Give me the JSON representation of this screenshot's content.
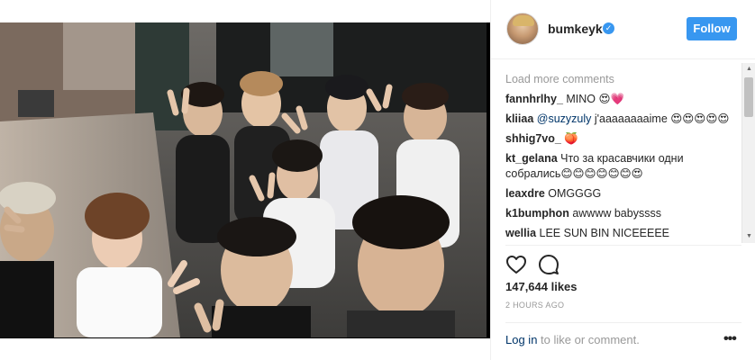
{
  "post": {
    "username": "bumkeyk",
    "verified_mark": "✓",
    "follow_label": "Follow",
    "load_more": "Load more comments",
    "likes": "147,644 likes",
    "timestamp": "2 HOURS AGO",
    "login_link": "Log in",
    "login_rest": " to like or comment.",
    "more_options": "•••"
  },
  "comments": [
    {
      "user": "fannhrlhy_",
      "text": " MINO 😍💗"
    },
    {
      "user": "kliiaa",
      "mention": " @suzyzuly",
      "text": " j'aaaaaaaaime 😍😍😍😍😍"
    },
    {
      "user": "shhig7vo_",
      "text": " 🍑"
    },
    {
      "user": "kt_gelana",
      "text": " Что за красавчики одни собрались😊😊😊😊😊😊😍"
    },
    {
      "user": "leaxdre",
      "text": " OMGGGG"
    },
    {
      "user": "k1bumphon",
      "text": " awwww babyssss"
    },
    {
      "user": "wellia",
      "text": " LEE SUN BIN NICEEEEE"
    }
  ],
  "icons": {
    "like": "heart-icon",
    "comment": "comment-icon",
    "avatar": "avatar"
  },
  "colors": {
    "accent": "#3897f0",
    "link": "#003569",
    "muted": "#999999"
  }
}
